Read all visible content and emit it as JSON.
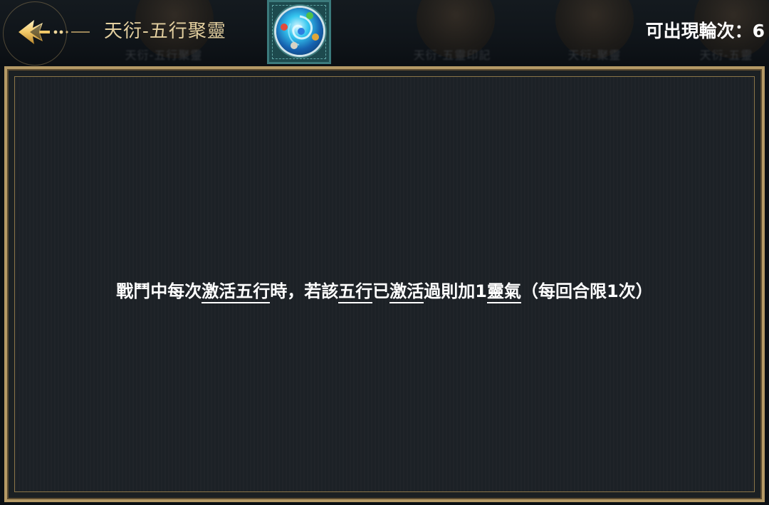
{
  "header": {
    "title": "天衍-五行聚靈",
    "rounds_label": "可出現輪次：6",
    "back_icon": "back-arrow-icon",
    "emblem_icon": "five-elements-orb-icon",
    "background_cards": [
      "天衍-五行聚靈",
      "天衍-五靈印記",
      "天衍-聚靈",
      "天衍-五靈"
    ]
  },
  "description": {
    "segments": [
      {
        "text": "戰鬥中每次",
        "keyword": false
      },
      {
        "text": "激活五行",
        "keyword": true
      },
      {
        "text": "時，若該",
        "keyword": false
      },
      {
        "text": "五行",
        "keyword": true
      },
      {
        "text": "已",
        "keyword": false
      },
      {
        "text": "激活",
        "keyword": true
      },
      {
        "text": "過則加1",
        "keyword": false
      },
      {
        "text": "靈氣",
        "keyword": true
      },
      {
        "text": "（每回合限1次）",
        "keyword": false
      }
    ]
  },
  "colors": {
    "title_gold": "#e3cf9f",
    "frame_gold": "#b59a66",
    "panel_bg": "#1c2126",
    "emblem_teal": "#1d4a4e",
    "text_white": "#ffffff"
  }
}
